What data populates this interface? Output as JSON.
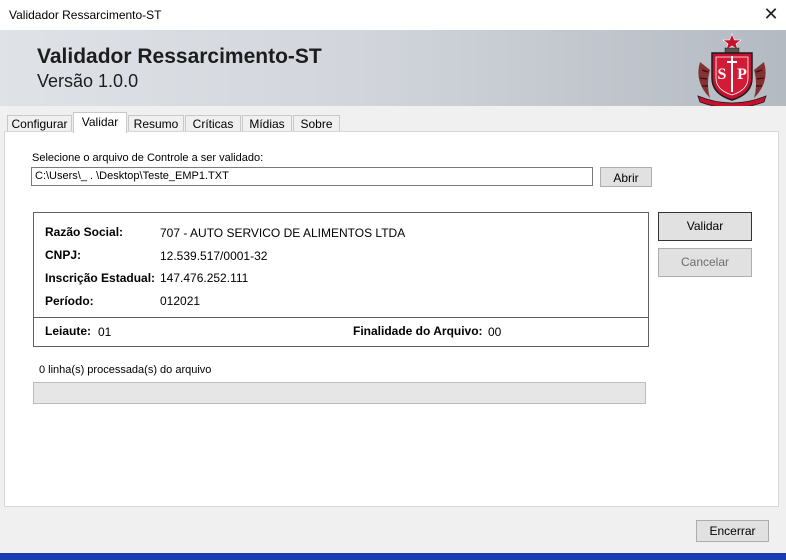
{
  "window": {
    "title": "Validador Ressarcimento-ST",
    "close_glyph": "✕",
    "close_icon": "close-icon"
  },
  "header": {
    "app_name": "Validador Ressarcimento-ST",
    "version": "Versão 1.0.0",
    "emblem": {
      "text": "SP",
      "icon": "sao-paulo-coat-of-arms-emblem",
      "colors": {
        "red": "#c8102e",
        "black": "#1a1a1a",
        "white": "#ffffff"
      }
    }
  },
  "tabs": [
    {
      "label": "Configurar",
      "active": false
    },
    {
      "label": "Validar",
      "active": true
    },
    {
      "label": "Resumo",
      "active": false
    },
    {
      "label": "Críticas",
      "active": false
    },
    {
      "label": "Mídias",
      "active": false
    },
    {
      "label": "Sobre",
      "active": false
    }
  ],
  "validar": {
    "select_label": "Selecione o arquivo de Controle a ser validado:",
    "file_path": "C:\\Users\\_          .      \\Desktop\\Teste_EMP1.TXT",
    "open_button": "Abrir",
    "validate_button": "Validar",
    "cancel_button": "Cancelar",
    "info": {
      "razao_social_label": "Razão Social:",
      "razao_social_value": "707 - AUTO SERVICO DE ALIMENTOS LTDA",
      "cnpj_label": "CNPJ:",
      "cnpj_value": "12.539.517/0001-32",
      "ie_label": "Inscrição Estadual:",
      "ie_value": "147.476.252.111",
      "periodo_label": "Período:",
      "periodo_value": "012021",
      "leiaute_label": "Leiaute:",
      "leiaute_value": "01",
      "finalidade_label": "Finalidade do Arquivo:",
      "finalidade_value": "00"
    },
    "progress_text": "0 linha(s) processada(s) do arquivo",
    "progress_fraction": 0
  },
  "footer": {
    "close_button": "Encerrar"
  },
  "colors": {
    "taskbar": "#1b3bb3",
    "progress_fill": "#06b025"
  }
}
